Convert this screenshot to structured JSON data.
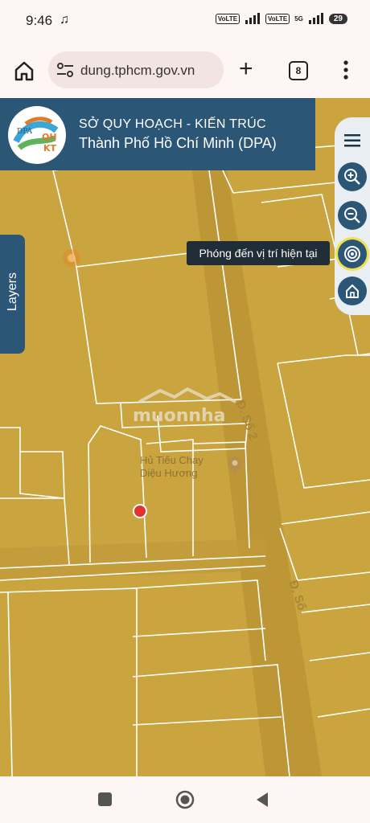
{
  "status_bar": {
    "time": "9:46",
    "battery": "29",
    "network_1": "VoLTE",
    "network_2": "VoLTE",
    "network_gen": "5G"
  },
  "browser": {
    "url": "dung.tphcm.gov.vn",
    "tab_count": "8"
  },
  "header": {
    "agency": "SỞ QUY HOẠCH - KIẾN TRÚC",
    "city": "Thành Phố Hồ Chí Minh (DPA)",
    "logo_text_left": "DPA",
    "logo_text_right": "QH KT"
  },
  "layers_tab": {
    "label": "Layers"
  },
  "tooltip": {
    "text": "Phóng đến vị trí hiện tại"
  },
  "map": {
    "poi_name_line1": "Hủ Tiếu Chay",
    "poi_name_line2": "Diệu Hương",
    "road_label_1": "Đ. Số 2",
    "road_label_2": "Đ. Số",
    "watermark": "muonnha",
    "colors": {
      "land": "#c9a43f",
      "road": "#b89234",
      "parcel_line": "#ffffff",
      "header": "#2b5676",
      "marker": "#e53030"
    }
  },
  "toolbar": {
    "buttons": [
      "menu-icon",
      "zoom-in-icon",
      "zoom-out-icon",
      "locate-icon",
      "home-icon"
    ]
  }
}
